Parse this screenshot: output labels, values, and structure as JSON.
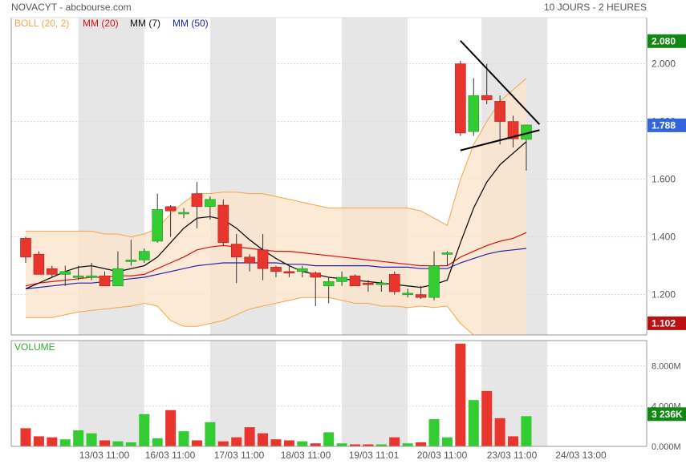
{
  "header": {
    "title": "NOVACYT - abcbourse.com",
    "period": "10 JOURS - 2 HEURES"
  },
  "colors": {
    "up": "#33cc33",
    "down": "#e8352d",
    "boll_line": "#f5a54a",
    "boll_fill": "#fbe5cc",
    "mm20": "#dd1111",
    "mm7": "#111111",
    "mm50": "#2222aa",
    "shade": "#e6e6e6",
    "grid": "#d8d8d8",
    "axis_text": "#555555",
    "badge_green": "#118811",
    "badge_blue": "#3366dd",
    "badge_red": "#bb1111",
    "volume_label": "#33aa33"
  },
  "legend": [
    {
      "label": "BOLL (20, 2)",
      "color": "#f5a54a"
    },
    {
      "label": "MM (20)",
      "color": "#dd1111"
    },
    {
      "label": "MM (7)",
      "color": "#111111"
    },
    {
      "label": "MM (50)",
      "color": "#2222aa"
    }
  ],
  "chart_data": [
    {
      "type": "candlestick",
      "ylim": [
        1.06,
        2.16
      ],
      "y_ticks": [
        1.2,
        1.4,
        1.6,
        1.8,
        2.0
      ],
      "y_tick_labels": [
        "1.200",
        "1.400",
        "1.600",
        "1.800",
        "2.000"
      ],
      "x_labels": [
        "13/03 11:00",
        "16/03 11:00",
        "17/03 11:00",
        "18/03 11:00",
        "19/03 11:01",
        "20/03 11:00",
        "23/03 11:00",
        "24/03 13:00"
      ],
      "candles": [
        {
          "o": 1.395,
          "h": 1.4,
          "l": 1.31,
          "c": 1.33
        },
        {
          "o": 1.34,
          "h": 1.35,
          "l": 1.27,
          "c": 1.27
        },
        {
          "o": 1.29,
          "h": 1.3,
          "l": 1.26,
          "c": 1.27
        },
        {
          "o": 1.27,
          "h": 1.3,
          "l": 1.23,
          "c": 1.28
        },
        {
          "o": 1.265,
          "h": 1.3,
          "l": 1.25,
          "c": 1.265
        },
        {
          "o": 1.265,
          "h": 1.31,
          "l": 1.25,
          "c": 1.265
        },
        {
          "o": 1.265,
          "h": 1.28,
          "l": 1.24,
          "c": 1.23
        },
        {
          "o": 1.23,
          "h": 1.35,
          "l": 1.23,
          "c": 1.29
        },
        {
          "o": 1.32,
          "h": 1.39,
          "l": 1.3,
          "c": 1.32
        },
        {
          "o": 1.32,
          "h": 1.36,
          "l": 1.31,
          "c": 1.35
        },
        {
          "o": 1.385,
          "h": 1.55,
          "l": 1.38,
          "c": 1.495
        },
        {
          "o": 1.505,
          "h": 1.51,
          "l": 1.4,
          "c": 1.49
        },
        {
          "o": 1.485,
          "h": 1.5,
          "l": 1.465,
          "c": 1.485
        },
        {
          "o": 1.55,
          "h": 1.59,
          "l": 1.43,
          "c": 1.505
        },
        {
          "o": 1.505,
          "h": 1.54,
          "l": 1.46,
          "c": 1.53
        },
        {
          "o": 1.51,
          "h": 1.53,
          "l": 1.37,
          "c": 1.38
        },
        {
          "o": 1.375,
          "h": 1.41,
          "l": 1.24,
          "c": 1.33
        },
        {
          "o": 1.33,
          "h": 1.34,
          "l": 1.28,
          "c": 1.31
        },
        {
          "o": 1.355,
          "h": 1.41,
          "l": 1.25,
          "c": 1.29
        },
        {
          "o": 1.295,
          "h": 1.3,
          "l": 1.26,
          "c": 1.28
        },
        {
          "o": 1.28,
          "h": 1.3,
          "l": 1.26,
          "c": 1.275
        },
        {
          "o": 1.28,
          "h": 1.3,
          "l": 1.26,
          "c": 1.29
        },
        {
          "o": 1.275,
          "h": 1.28,
          "l": 1.16,
          "c": 1.26
        },
        {
          "o": 1.23,
          "h": 1.26,
          "l": 1.17,
          "c": 1.245
        },
        {
          "o": 1.245,
          "h": 1.28,
          "l": 1.23,
          "c": 1.26
        },
        {
          "o": 1.265,
          "h": 1.27,
          "l": 1.23,
          "c": 1.23
        },
        {
          "o": 1.24,
          "h": 1.25,
          "l": 1.21,
          "c": 1.235
        },
        {
          "o": 1.235,
          "h": 1.25,
          "l": 1.21,
          "c": 1.24
        },
        {
          "o": 1.27,
          "h": 1.28,
          "l": 1.2,
          "c": 1.21
        },
        {
          "o": 1.205,
          "h": 1.22,
          "l": 1.19,
          "c": 1.205
        },
        {
          "o": 1.2,
          "h": 1.23,
          "l": 1.185,
          "c": 1.19
        },
        {
          "o": 1.19,
          "h": 1.35,
          "l": 1.18,
          "c": 1.3
        },
        {
          "o": 1.345,
          "h": 1.35,
          "l": 1.3,
          "c": 1.345
        },
        {
          "o": 2.0,
          "h": 2.01,
          "l": 1.75,
          "c": 1.76
        },
        {
          "o": 1.765,
          "h": 1.95,
          "l": 1.75,
          "c": 1.89
        },
        {
          "o": 1.89,
          "h": 2.0,
          "l": 1.86,
          "c": 1.875
        },
        {
          "o": 1.87,
          "h": 1.89,
          "l": 1.72,
          "c": 1.8
        },
        {
          "o": 1.8,
          "h": 1.82,
          "l": 1.71,
          "c": 1.74
        },
        {
          "o": 1.738,
          "h": 1.78,
          "l": 1.63,
          "c": 1.788
        }
      ],
      "bollinger_upper": [
        1.42,
        1.42,
        1.42,
        1.42,
        1.42,
        1.42,
        1.41,
        1.41,
        1.4,
        1.41,
        1.43,
        1.48,
        1.52,
        1.55,
        1.55,
        1.555,
        1.555,
        1.55,
        1.55,
        1.54,
        1.53,
        1.52,
        1.51,
        1.5,
        1.5,
        1.5,
        1.5,
        1.5,
        1.5,
        1.5,
        1.49,
        1.465,
        1.44,
        1.6,
        1.72,
        1.8,
        1.87,
        1.91,
        1.95
      ],
      "bollinger_lower": [
        1.12,
        1.12,
        1.12,
        1.13,
        1.14,
        1.145,
        1.15,
        1.155,
        1.16,
        1.17,
        1.16,
        1.11,
        1.09,
        1.09,
        1.1,
        1.11,
        1.13,
        1.15,
        1.16,
        1.17,
        1.18,
        1.19,
        1.19,
        1.19,
        1.18,
        1.17,
        1.17,
        1.16,
        1.16,
        1.155,
        1.16,
        1.155,
        1.16,
        1.1,
        1.06,
        1.06,
        1.06,
        1.06,
        1.06
      ],
      "mm20": [
        1.23,
        1.24,
        1.245,
        1.25,
        1.255,
        1.26,
        1.26,
        1.265,
        1.265,
        1.27,
        1.29,
        1.31,
        1.33,
        1.355,
        1.365,
        1.37,
        1.365,
        1.36,
        1.355,
        1.35,
        1.35,
        1.345,
        1.34,
        1.335,
        1.33,
        1.325,
        1.32,
        1.315,
        1.31,
        1.305,
        1.3,
        1.3,
        1.3,
        1.33,
        1.35,
        1.37,
        1.385,
        1.395,
        1.415
      ],
      "mm7": [
        1.22,
        1.24,
        1.26,
        1.28,
        1.295,
        1.3,
        1.29,
        1.28,
        1.29,
        1.3,
        1.33,
        1.38,
        1.43,
        1.465,
        1.47,
        1.46,
        1.43,
        1.39,
        1.355,
        1.325,
        1.3,
        1.28,
        1.27,
        1.26,
        1.255,
        1.25,
        1.245,
        1.24,
        1.235,
        1.23,
        1.225,
        1.235,
        1.25,
        1.38,
        1.5,
        1.59,
        1.65,
        1.69,
        1.73
      ],
      "mm50": [
        1.22,
        1.225,
        1.23,
        1.235,
        1.24,
        1.24,
        1.245,
        1.25,
        1.255,
        1.26,
        1.27,
        1.28,
        1.29,
        1.3,
        1.305,
        1.31,
        1.31,
        1.31,
        1.31,
        1.31,
        1.305,
        1.305,
        1.3,
        1.3,
        1.3,
        1.3,
        1.3,
        1.295,
        1.295,
        1.295,
        1.29,
        1.29,
        1.29,
        1.31,
        1.325,
        1.34,
        1.35,
        1.355,
        1.36
      ],
      "triangle": {
        "upper": [
          [
            33,
            2.08
          ],
          [
            39,
            1.79
          ]
        ],
        "lower": [
          [
            33,
            1.7
          ],
          [
            39,
            1.77
          ]
        ]
      },
      "badges": [
        {
          "value": 2.08,
          "label": "2.080",
          "color": "#118811"
        },
        {
          "value": 1.788,
          "label": "1.788",
          "color": "#3366dd"
        },
        {
          "value": 1.102,
          "label": "1.102",
          "color": "#bb1111"
        }
      ]
    },
    {
      "type": "bar",
      "title": "VOLUME",
      "ylim": [
        0,
        10.5
      ],
      "y_ticks": [
        0,
        4,
        8
      ],
      "y_tick_labels": [
        "0.000M",
        "4.000M",
        "8.000M"
      ],
      "values": [
        1.8,
        1.0,
        0.9,
        0.7,
        1.6,
        1.3,
        0.6,
        0.5,
        0.4,
        3.2,
        0.8,
        3.6,
        1.5,
        0.6,
        2.4,
        0.5,
        0.9,
        1.9,
        1.3,
        0.7,
        0.6,
        0.5,
        0.3,
        1.4,
        0.3,
        0.2,
        0.2,
        0.2,
        0.9,
        0.3,
        0.4,
        2.7,
        0.9,
        10.2,
        4.6,
        5.5,
        2.8,
        1.0,
        3.0
      ],
      "badge": {
        "value": 3.236,
        "label": "3 236K",
        "color": "#118811"
      }
    }
  ]
}
